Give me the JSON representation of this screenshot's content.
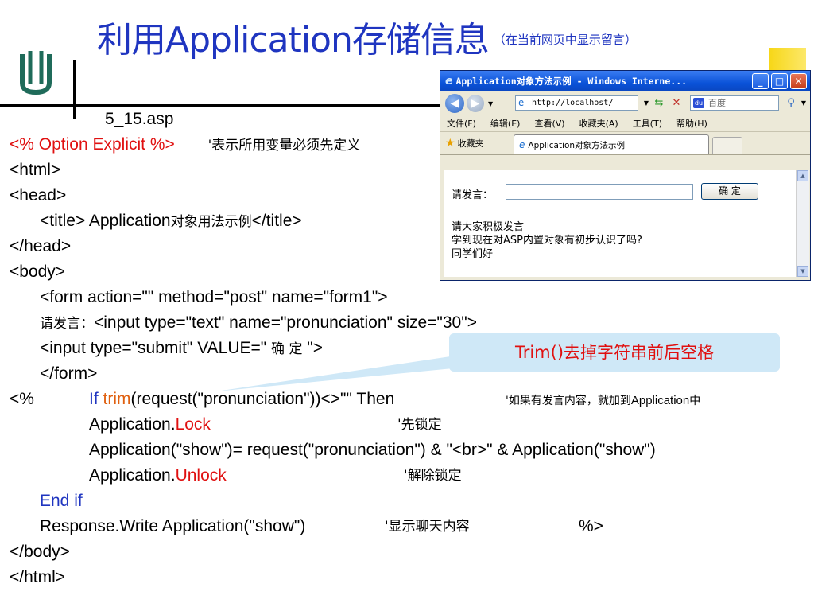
{
  "slide": {
    "title": "利用Application存储信息",
    "subtitle": "（在当前网页中显示留言）",
    "filename": "5_15.asp",
    "colors": {
      "title_blue": "#1f35c0",
      "keyword_red": "#e01010",
      "trim_orange": "#e06010",
      "callout_bg": "#cfe8f7"
    },
    "logo_icon": "university-logo-icon"
  },
  "code": {
    "l1_a": "<% Option Explicit   %>",
    "l1_b": "'表示所用变量必须先定义",
    "l2": "<html>",
    "l3": "<head>",
    "l4_a": "<title> Application",
    "l4_b": "对象用法示例",
    "l4_c": "</title>",
    "l5": "</head>",
    "l6": "<body>",
    "l7": "<form  action=\"\"  method=\"post\"  name=\"form1\">",
    "l8_a": "请发言：",
    "l8_b": "<input type=\"text\" name=\"pronunciation\" size=\"30\">",
    "l9_a": "<input type=\"submit\" VALUE=\" ",
    "l9_b": "确 定",
    "l9_c": " \">",
    "l10": "</form>",
    "l11_open": "<%",
    "l11_if": "If ",
    "l11_trim": "trim",
    "l11_rest": "(request(\"pronunciation\"))<>\"\" Then",
    "l11_comment_a": "'如果有发言内容，就加到",
    "l11_comment_b": "Application",
    "l11_comment_c": "中",
    "l12_a": "Application.",
    "l12_b": "Lock",
    "l12_comment": "'先锁定",
    "l13": "Application(\"show\")= request(\"pronunciation\") & \"<br>\" & Application(\"show\")",
    "l14_a": "Application.",
    "l14_b": "Unlock",
    "l14_comment": "'解除锁定",
    "l15": "End if",
    "l16_a": "Response.Write Application(\"show\")",
    "l16_b": "'显示聊天内容",
    "l16_c": "%>",
    "l17": "</body>",
    "l18": "</html>"
  },
  "callout": {
    "prefix": "Trim()",
    "text": "去掉字符串前后空格"
  },
  "browser": {
    "window_title": "Application对象方法示例 - Windows Interne...",
    "minimize": "_",
    "maximize": "□",
    "close": "✕",
    "address": "http://localhost/",
    "search_placeholder": "百度",
    "search_engine_icon": "baidu-icon",
    "menu": [
      "文件(F)",
      "编辑(E)",
      "查看(V)",
      "收藏夹(A)",
      "工具(T)",
      "帮助(H)"
    ],
    "favorites": "收藏夹",
    "tab_title": "Application对象方法示例",
    "content": {
      "label": "请发言：",
      "input_value": "",
      "submit_label": "确 定",
      "messages": [
        "请大家积极发言",
        "学到现在对ASP内置对象有初步认识了吗?",
        "同学们好"
      ]
    }
  }
}
